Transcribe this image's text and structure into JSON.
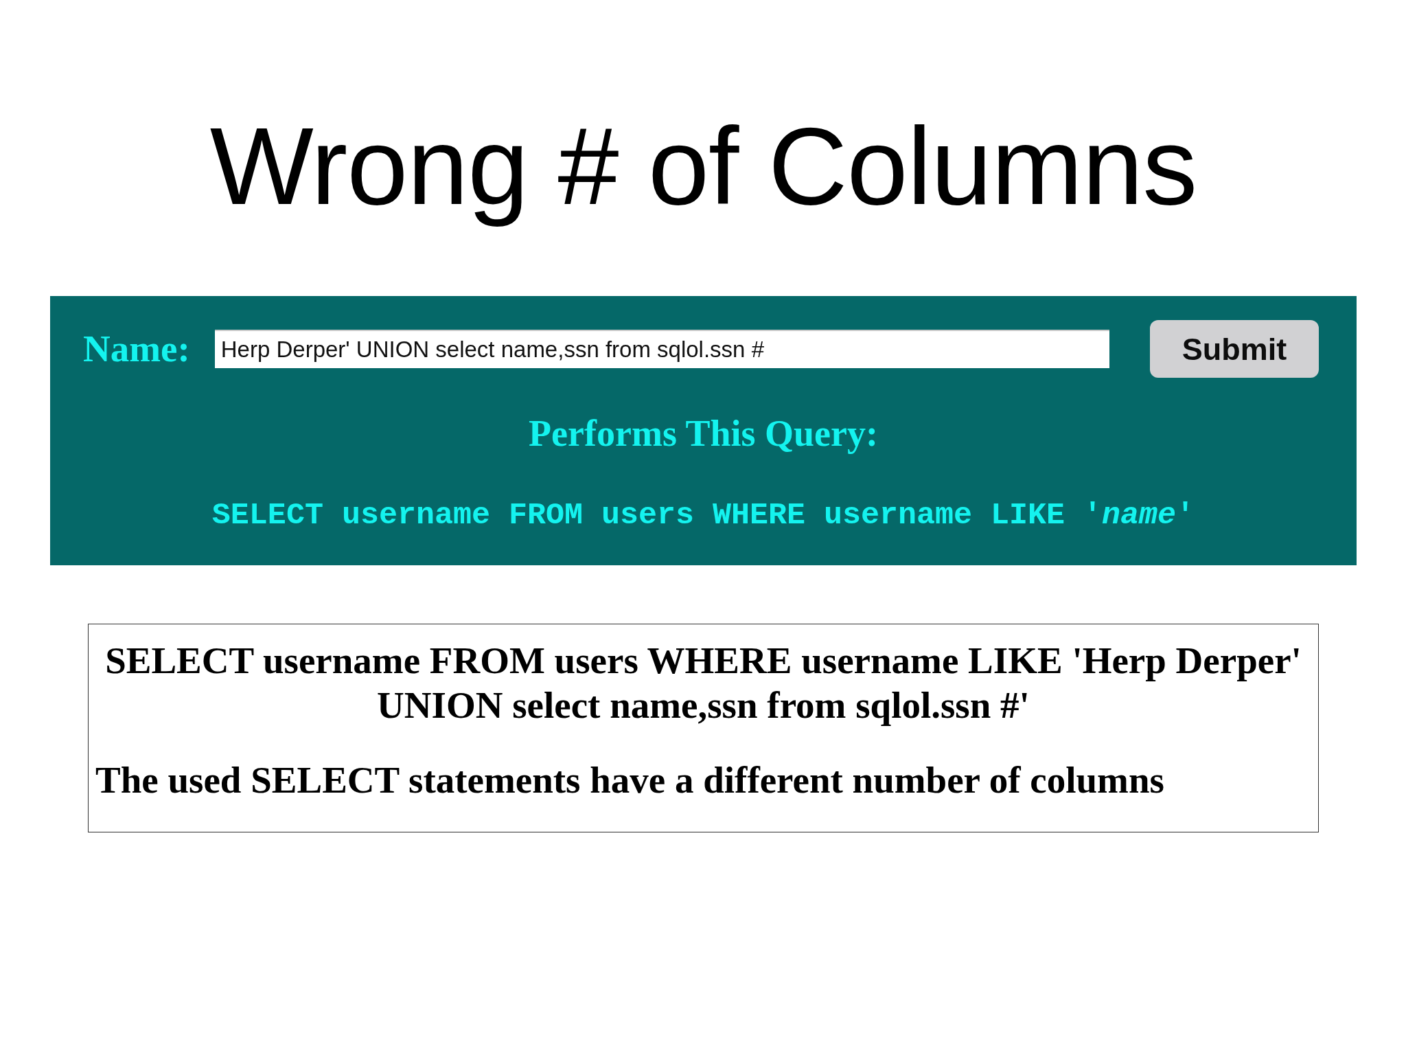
{
  "slide_title": "Wrong # of Columns",
  "form": {
    "label": "Name:",
    "value": "Herp Derper' UNION select name,ssn from sqlol.ssn #",
    "submit_button": "Submit"
  },
  "query_preview": {
    "heading": "Performs This Query:",
    "template": "SELECT username FROM users WHERE username LIKE '*name*'"
  },
  "result": {
    "query": "SELECT username FROM users WHERE username LIKE 'Herp Derper' UNION select name,ssn from sqlol.ssn #'",
    "error": "The used SELECT statements have a different number of columns"
  }
}
